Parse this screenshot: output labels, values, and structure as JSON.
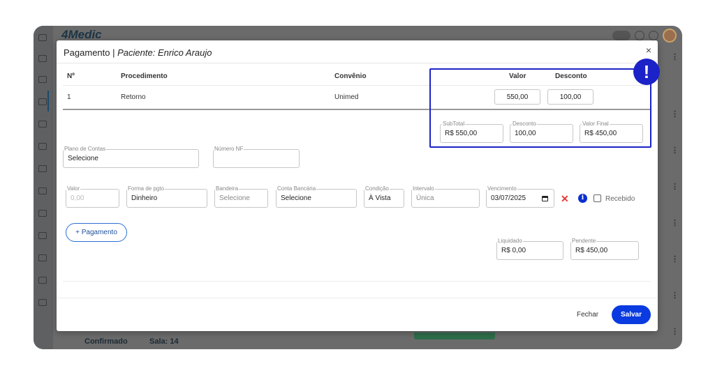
{
  "background": {
    "logo": "4Medic",
    "status_label": "Confirmado",
    "room_label": "Sala: 14",
    "colors": {
      "frame": "#6b6b6b",
      "accent_green": "#2e6d4a"
    }
  },
  "modal": {
    "title": "Pagamento",
    "separator": "|",
    "patient": "Paciente: Enrico Araujo",
    "close_glyph": "×"
  },
  "table": {
    "headers": {
      "num": "Nº",
      "procedimento": "Procedimento",
      "convenio": "Convênio",
      "valor": "Valor",
      "desconto": "Desconto"
    },
    "rows": [
      {
        "num": "1",
        "procedimento": "Retorno",
        "convenio": "Unimed",
        "valor": "550,00",
        "desconto": "100,00"
      }
    ]
  },
  "summary": {
    "subtotal_label": "SubTotal",
    "subtotal": "R$ 550,00",
    "desconto_label": "Desconto",
    "desconto": "100,00",
    "valor_final_label": "Valor Final",
    "valor_final": "R$ 450,00"
  },
  "fields": {
    "plano_label": "Plano de Contas",
    "plano_value": "Selecione",
    "nf_label": "Número NF",
    "nf_value": ""
  },
  "payment": {
    "valor_label": "Valor",
    "valor_placeholder": "0,00",
    "forma_label": "Forma de pgto",
    "forma_value": "Dinheiro",
    "bandeira_label": "Bandeira",
    "bandeira_value": "Selecione",
    "conta_label": "Conta Bancária",
    "conta_value": "Selecione",
    "condicao_label": "Condição",
    "condicao_value": "À Vista",
    "intervalo_label": "Intervalo",
    "intervalo_value": "Única",
    "vencimento_label": "Vencimento",
    "vencimento_value": "03/07/2025",
    "remove_glyph": "✕",
    "info_glyph": "i",
    "recebido_label": "Recebido"
  },
  "add_payment_label": "+ Pagamento",
  "totals": {
    "liquidado_label": "Liquidado",
    "liquidado": "R$ 0,00",
    "pendente_label": "Pendente",
    "pendente": "R$ 450,00"
  },
  "footer": {
    "fechar": "Fechar",
    "salvar": "Salvar"
  },
  "callout": {
    "glyph": "!",
    "color": "#1b22c7"
  }
}
